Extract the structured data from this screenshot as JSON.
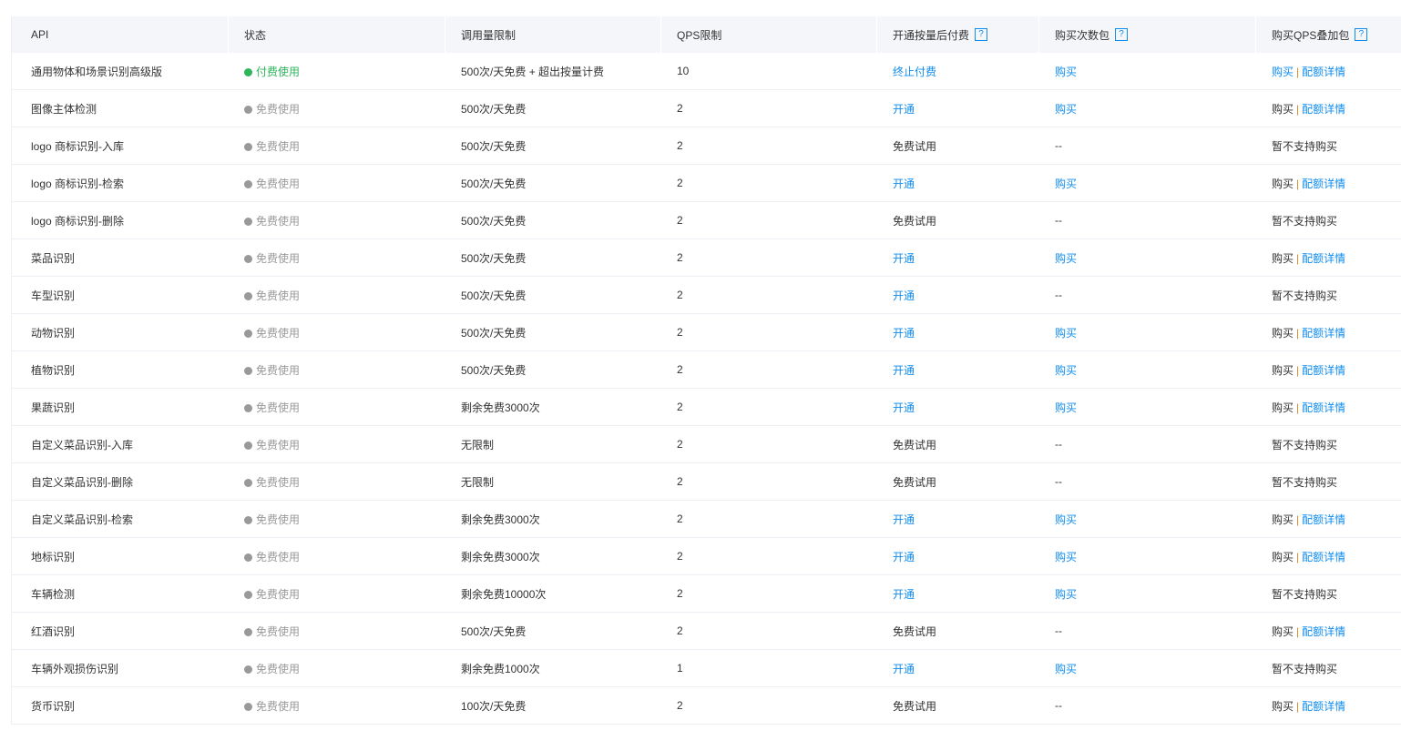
{
  "headers": {
    "api": "API",
    "status": "状态",
    "quota": "调用量限制",
    "qps": "QPS限制",
    "postpay": "开通按量后付费",
    "pack": "购买次数包",
    "qps_pack": "购买QPS叠加包",
    "help": "?"
  },
  "labels": {
    "buy": "购买",
    "detail": "配额详情",
    "unsupported": "暂不支持购买",
    "sep": "|"
  },
  "colors": {
    "link": "#108cee",
    "paid": "#2cb55b",
    "free": "#999999",
    "separator": "#d48a2c"
  },
  "rows": [
    {
      "api": "通用物体和场景识别高级版",
      "status": "付费使用",
      "paid": true,
      "quota": "500次/天免费 + 超出按量计费",
      "qps": "10",
      "postpay": "终止付费",
      "postpay_link": true,
      "pack": "购买",
      "pack_link": true,
      "qps_buy": "link"
    },
    {
      "api": "图像主体检测",
      "status": "免费使用",
      "paid": false,
      "quota": "500次/天免费",
      "qps": "2",
      "postpay": "开通",
      "postpay_link": true,
      "pack": "购买",
      "pack_link": true,
      "qps_buy": "plain"
    },
    {
      "api": "logo 商标识别-入库",
      "status": "免费使用",
      "paid": false,
      "quota": "500次/天免费",
      "qps": "2",
      "postpay": "免费试用",
      "postpay_link": false,
      "pack": "--",
      "pack_link": false,
      "qps_buy": "none"
    },
    {
      "api": "logo 商标识别-检索",
      "status": "免费使用",
      "paid": false,
      "quota": "500次/天免费",
      "qps": "2",
      "postpay": "开通",
      "postpay_link": true,
      "pack": "购买",
      "pack_link": true,
      "qps_buy": "plain"
    },
    {
      "api": "logo 商标识别-删除",
      "status": "免费使用",
      "paid": false,
      "quota": "500次/天免费",
      "qps": "2",
      "postpay": "免费试用",
      "postpay_link": false,
      "pack": "--",
      "pack_link": false,
      "qps_buy": "none"
    },
    {
      "api": "菜品识别",
      "status": "免费使用",
      "paid": false,
      "quota": "500次/天免费",
      "qps": "2",
      "postpay": "开通",
      "postpay_link": true,
      "pack": "购买",
      "pack_link": true,
      "qps_buy": "plain"
    },
    {
      "api": "车型识别",
      "status": "免费使用",
      "paid": false,
      "quota": "500次/天免费",
      "qps": "2",
      "postpay": "开通",
      "postpay_link": true,
      "pack": "--",
      "pack_link": false,
      "qps_buy": "none"
    },
    {
      "api": "动物识别",
      "status": "免费使用",
      "paid": false,
      "quota": "500次/天免费",
      "qps": "2",
      "postpay": "开通",
      "postpay_link": true,
      "pack": "购买",
      "pack_link": true,
      "qps_buy": "plain"
    },
    {
      "api": "植物识别",
      "status": "免费使用",
      "paid": false,
      "quota": "500次/天免费",
      "qps": "2",
      "postpay": "开通",
      "postpay_link": true,
      "pack": "购买",
      "pack_link": true,
      "qps_buy": "plain"
    },
    {
      "api": "果蔬识别",
      "status": "免费使用",
      "paid": false,
      "quota": "剩余免费3000次",
      "qps": "2",
      "postpay": "开通",
      "postpay_link": true,
      "pack": "购买",
      "pack_link": true,
      "qps_buy": "plain"
    },
    {
      "api": "自定义菜品识别-入库",
      "status": "免费使用",
      "paid": false,
      "quota": "无限制",
      "qps": "2",
      "postpay": "免费试用",
      "postpay_link": false,
      "pack": "--",
      "pack_link": false,
      "qps_buy": "none"
    },
    {
      "api": "自定义菜品识别-删除",
      "status": "免费使用",
      "paid": false,
      "quota": "无限制",
      "qps": "2",
      "postpay": "免费试用",
      "postpay_link": false,
      "pack": "--",
      "pack_link": false,
      "qps_buy": "none"
    },
    {
      "api": "自定义菜品识别-检索",
      "status": "免费使用",
      "paid": false,
      "quota": "剩余免费3000次",
      "qps": "2",
      "postpay": "开通",
      "postpay_link": true,
      "pack": "购买",
      "pack_link": true,
      "qps_buy": "plain"
    },
    {
      "api": "地标识别",
      "status": "免费使用",
      "paid": false,
      "quota": "剩余免费3000次",
      "qps": "2",
      "postpay": "开通",
      "postpay_link": true,
      "pack": "购买",
      "pack_link": true,
      "qps_buy": "plain"
    },
    {
      "api": "车辆检测",
      "status": "免费使用",
      "paid": false,
      "quota": "剩余免费10000次",
      "qps": "2",
      "postpay": "开通",
      "postpay_link": true,
      "pack": "购买",
      "pack_link": true,
      "qps_buy": "none"
    },
    {
      "api": "红酒识别",
      "status": "免费使用",
      "paid": false,
      "quota": "500次/天免费",
      "qps": "2",
      "postpay": "免费试用",
      "postpay_link": false,
      "pack": "--",
      "pack_link": false,
      "qps_buy": "plain"
    },
    {
      "api": "车辆外观损伤识别",
      "status": "免费使用",
      "paid": false,
      "quota": "剩余免费1000次",
      "qps": "1",
      "postpay": "开通",
      "postpay_link": true,
      "pack": "购买",
      "pack_link": true,
      "qps_buy": "none"
    },
    {
      "api": "货币识别",
      "status": "免费使用",
      "paid": false,
      "quota": "100次/天免费",
      "qps": "2",
      "postpay": "免费试用",
      "postpay_link": false,
      "pack": "--",
      "pack_link": false,
      "qps_buy": "plain"
    }
  ]
}
